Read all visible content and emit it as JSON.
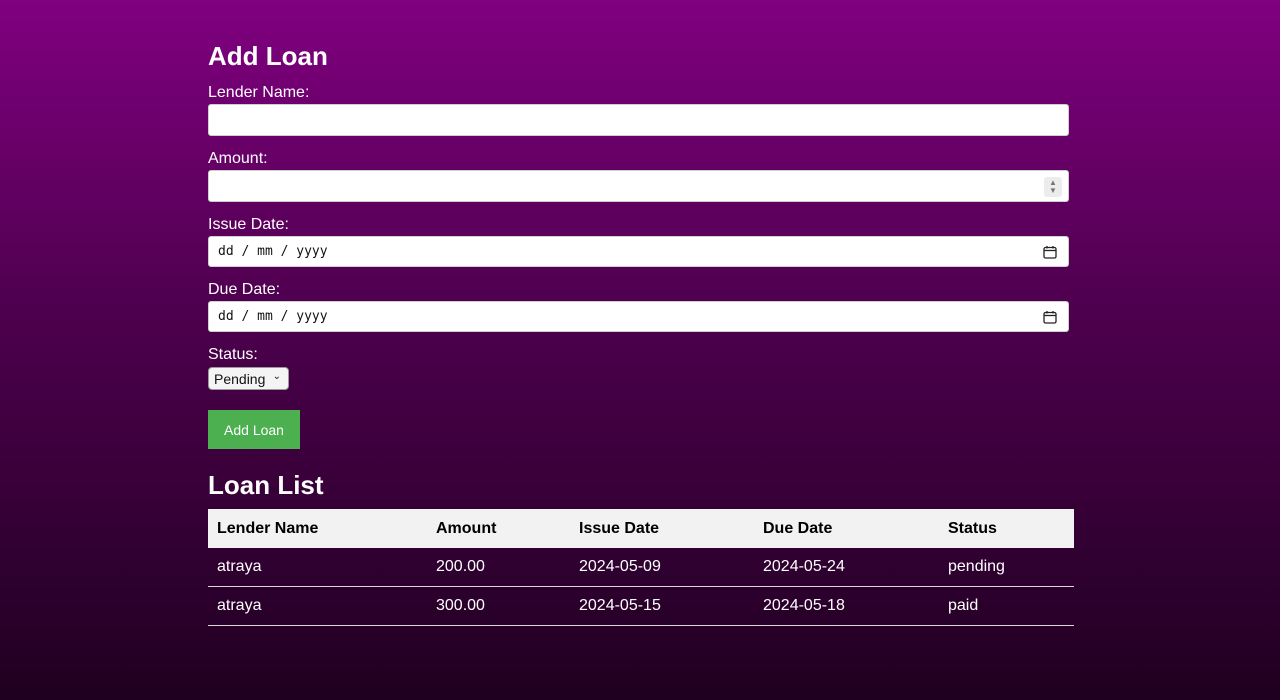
{
  "form": {
    "title": "Add Loan",
    "lender_label": "Lender Name:",
    "lender_value": "",
    "amount_label": "Amount:",
    "amount_value": "",
    "issue_label": "Issue Date:",
    "issue_placeholder": "dd / mm / yyyy",
    "due_label": "Due Date:",
    "due_placeholder": "dd / mm / yyyy",
    "status_label": "Status:",
    "status_selected": "Pending",
    "submit_label": "Add Loan"
  },
  "list": {
    "title": "Loan List",
    "columns": [
      "Lender Name",
      "Amount",
      "Issue Date",
      "Due Date",
      "Status"
    ],
    "rows": [
      [
        "atraya",
        "200.00",
        "2024-05-09",
        "2024-05-24",
        "pending"
      ],
      [
        "atraya",
        "300.00",
        "2024-05-15",
        "2024-05-18",
        "paid"
      ]
    ]
  },
  "colors": {
    "background_top": "#800080",
    "background_bottom": "#1f0020",
    "button": "#4caf50",
    "table_header": "#f2f2f2"
  }
}
